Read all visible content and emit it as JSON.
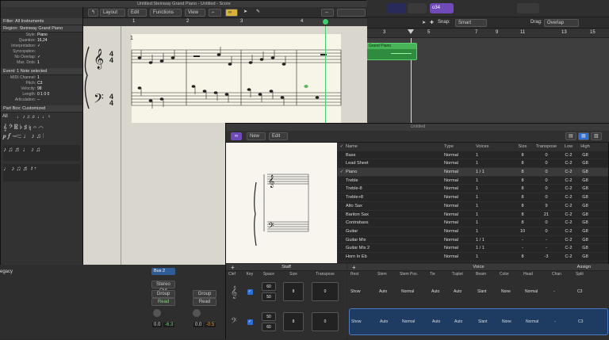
{
  "arrange": {
    "counter": "o34",
    "snap_label": "Snap:",
    "snap_value": "Smart",
    "drag_label": "Drag:",
    "drag_value": "Overlap",
    "ruler": [
      "3",
      "5",
      "7",
      "9",
      "11",
      "13",
      "15"
    ],
    "region_name": "Grand Piano"
  },
  "score": {
    "window_title": "Untitled:Steinway Grand Piano - Untitled - Score",
    "toolbar": {
      "layout": "Layout",
      "edit": "Edit",
      "functions": "Functions",
      "view": "View"
    },
    "ruler": [
      "1",
      "2",
      "3",
      "4"
    ],
    "measure_number": "1",
    "inspector": {
      "filter": "Filter: All Instruments",
      "region_header": "Region: Steinway Grand Piano",
      "region_fields": [
        {
          "k": "Style:",
          "v": "Piano"
        },
        {
          "k": "Quantize:",
          "v": "16,24"
        },
        {
          "k": "Interpretation:",
          "v": "✓"
        },
        {
          "k": "Syncopation:",
          "v": ""
        },
        {
          "k": "No Overlap:",
          "v": "✓"
        },
        {
          "k": "Max. Dots:",
          "v": "1"
        }
      ],
      "event_header": "Event: 1 Note selected",
      "event_fields": [
        {
          "k": "MIDI Channel:",
          "v": "1"
        },
        {
          "k": "Pitch:",
          "v": "C3"
        },
        {
          "k": "Velocity:",
          "v": "98"
        },
        {
          "k": "Length:",
          "v": "0 1 0     0"
        },
        {
          "k": "Articulation:",
          "v": "--"
        }
      ],
      "partbox_header": "Part Box: Customized",
      "partbox_all": "All"
    }
  },
  "mixer": {
    "legacy_label": "egacy",
    "bus": "Bus 2",
    "stereo_out": "Stereo Out",
    "group": "Group",
    "read": "Read",
    "vals_a": [
      "0.0",
      "0.0"
    ],
    "vals_b": [
      "0.0",
      "-0.5"
    ],
    "vals_c": [
      "0.0",
      "-6.3"
    ]
  },
  "sets": {
    "title": "Untitled",
    "new_label": "New",
    "edit_label": "Edit",
    "columns": {
      "name": "Name",
      "type": "Type",
      "voices": "Voices",
      "size": "Size",
      "transpose": "Transpose",
      "low": "Low",
      "high": "High"
    },
    "instruments": [
      {
        "chk": "",
        "name": "Bass",
        "type": "Normal",
        "voices": "1",
        "size": "8",
        "transpose": "0",
        "low": "C-2",
        "high": "G8"
      },
      {
        "chk": "",
        "name": "Lead Sheet",
        "type": "Normal",
        "voices": "1",
        "size": "8",
        "transpose": "0",
        "low": "C-2",
        "high": "G8"
      },
      {
        "chk": "✓",
        "name": "Piano",
        "type": "Normal",
        "voices": "1 / 1",
        "size": "8",
        "transpose": "0",
        "low": "C-2",
        "high": "G8"
      },
      {
        "chk": "",
        "name": "Treble",
        "type": "Normal",
        "voices": "1",
        "size": "8",
        "transpose": "0",
        "low": "C-2",
        "high": "G8"
      },
      {
        "chk": "",
        "name": "Treble-8",
        "type": "Normal",
        "voices": "1",
        "size": "8",
        "transpose": "0",
        "low": "C-2",
        "high": "G8"
      },
      {
        "chk": "",
        "name": "Treble+8",
        "type": "Normal",
        "voices": "1",
        "size": "8",
        "transpose": "0",
        "low": "C-2",
        "high": "G8"
      },
      {
        "chk": "",
        "name": "Alto Sax",
        "type": "Normal",
        "voices": "1",
        "size": "8",
        "transpose": "9",
        "low": "C-2",
        "high": "G8"
      },
      {
        "chk": "",
        "name": "Bariton Sax",
        "type": "Normal",
        "voices": "1",
        "size": "8",
        "transpose": "21",
        "low": "C-2",
        "high": "G8"
      },
      {
        "chk": "",
        "name": "Contrabass",
        "type": "Normal",
        "voices": "1",
        "size": "8",
        "transpose": "0",
        "low": "C-2",
        "high": "G8"
      },
      {
        "chk": "",
        "name": "Guitar",
        "type": "Normal",
        "voices": "1",
        "size": "10",
        "transpose": "0",
        "low": "C-2",
        "high": "G8"
      },
      {
        "chk": "",
        "name": "Guitar Mix",
        "type": "Normal",
        "voices": "1 / 1",
        "size": "-",
        "transpose": "-",
        "low": "C-2",
        "high": "G8"
      },
      {
        "chk": "",
        "name": "Guitar Mix 2",
        "type": "Normal",
        "voices": "1 / 1",
        "size": "-",
        "transpose": "-",
        "low": "C-2",
        "high": "G8"
      },
      {
        "chk": "",
        "name": "Horn In Eb",
        "type": "Normal",
        "voices": "1",
        "size": "8",
        "transpose": "-3",
        "low": "C-2",
        "high": "G8"
      },
      {
        "chk": "",
        "name": "Horn In F",
        "type": "Normal",
        "voices": "1",
        "size": "8",
        "transpose": "7",
        "low": "C-2",
        "high": "G8"
      }
    ],
    "staff": {
      "header": "Staff",
      "cols": [
        "Clef",
        "Key",
        "Space",
        "Size",
        "Transpose"
      ],
      "rows": [
        {
          "space": [
            "60",
            "50"
          ],
          "size": "8",
          "transpose": "0"
        },
        {
          "space": [
            "50",
            "60"
          ],
          "size": "8",
          "transpose": "0"
        }
      ]
    },
    "voice": {
      "header": "Voice",
      "assign": "Assign",
      "cols": [
        "Rest",
        "Stem",
        "Stem Pos.",
        "Tie",
        "Tuplet",
        "Beam",
        "Color",
        "Head",
        "Chan",
        "Split"
      ],
      "rows": [
        {
          "rest": "Show",
          "stem": "Auto",
          "stempos": "Normal",
          "tie": "Auto",
          "tuplet": "Auto",
          "beam": "Slant",
          "color": "None",
          "head": "Normal",
          "chan": "-",
          "split": "C3"
        },
        {
          "rest": "Show",
          "stem": "Auto",
          "stempos": "Normal",
          "tie": "Auto",
          "tuplet": "Auto",
          "beam": "Slant",
          "color": "None",
          "head": "Normal",
          "chan": "-",
          "split": "C3"
        }
      ]
    }
  }
}
